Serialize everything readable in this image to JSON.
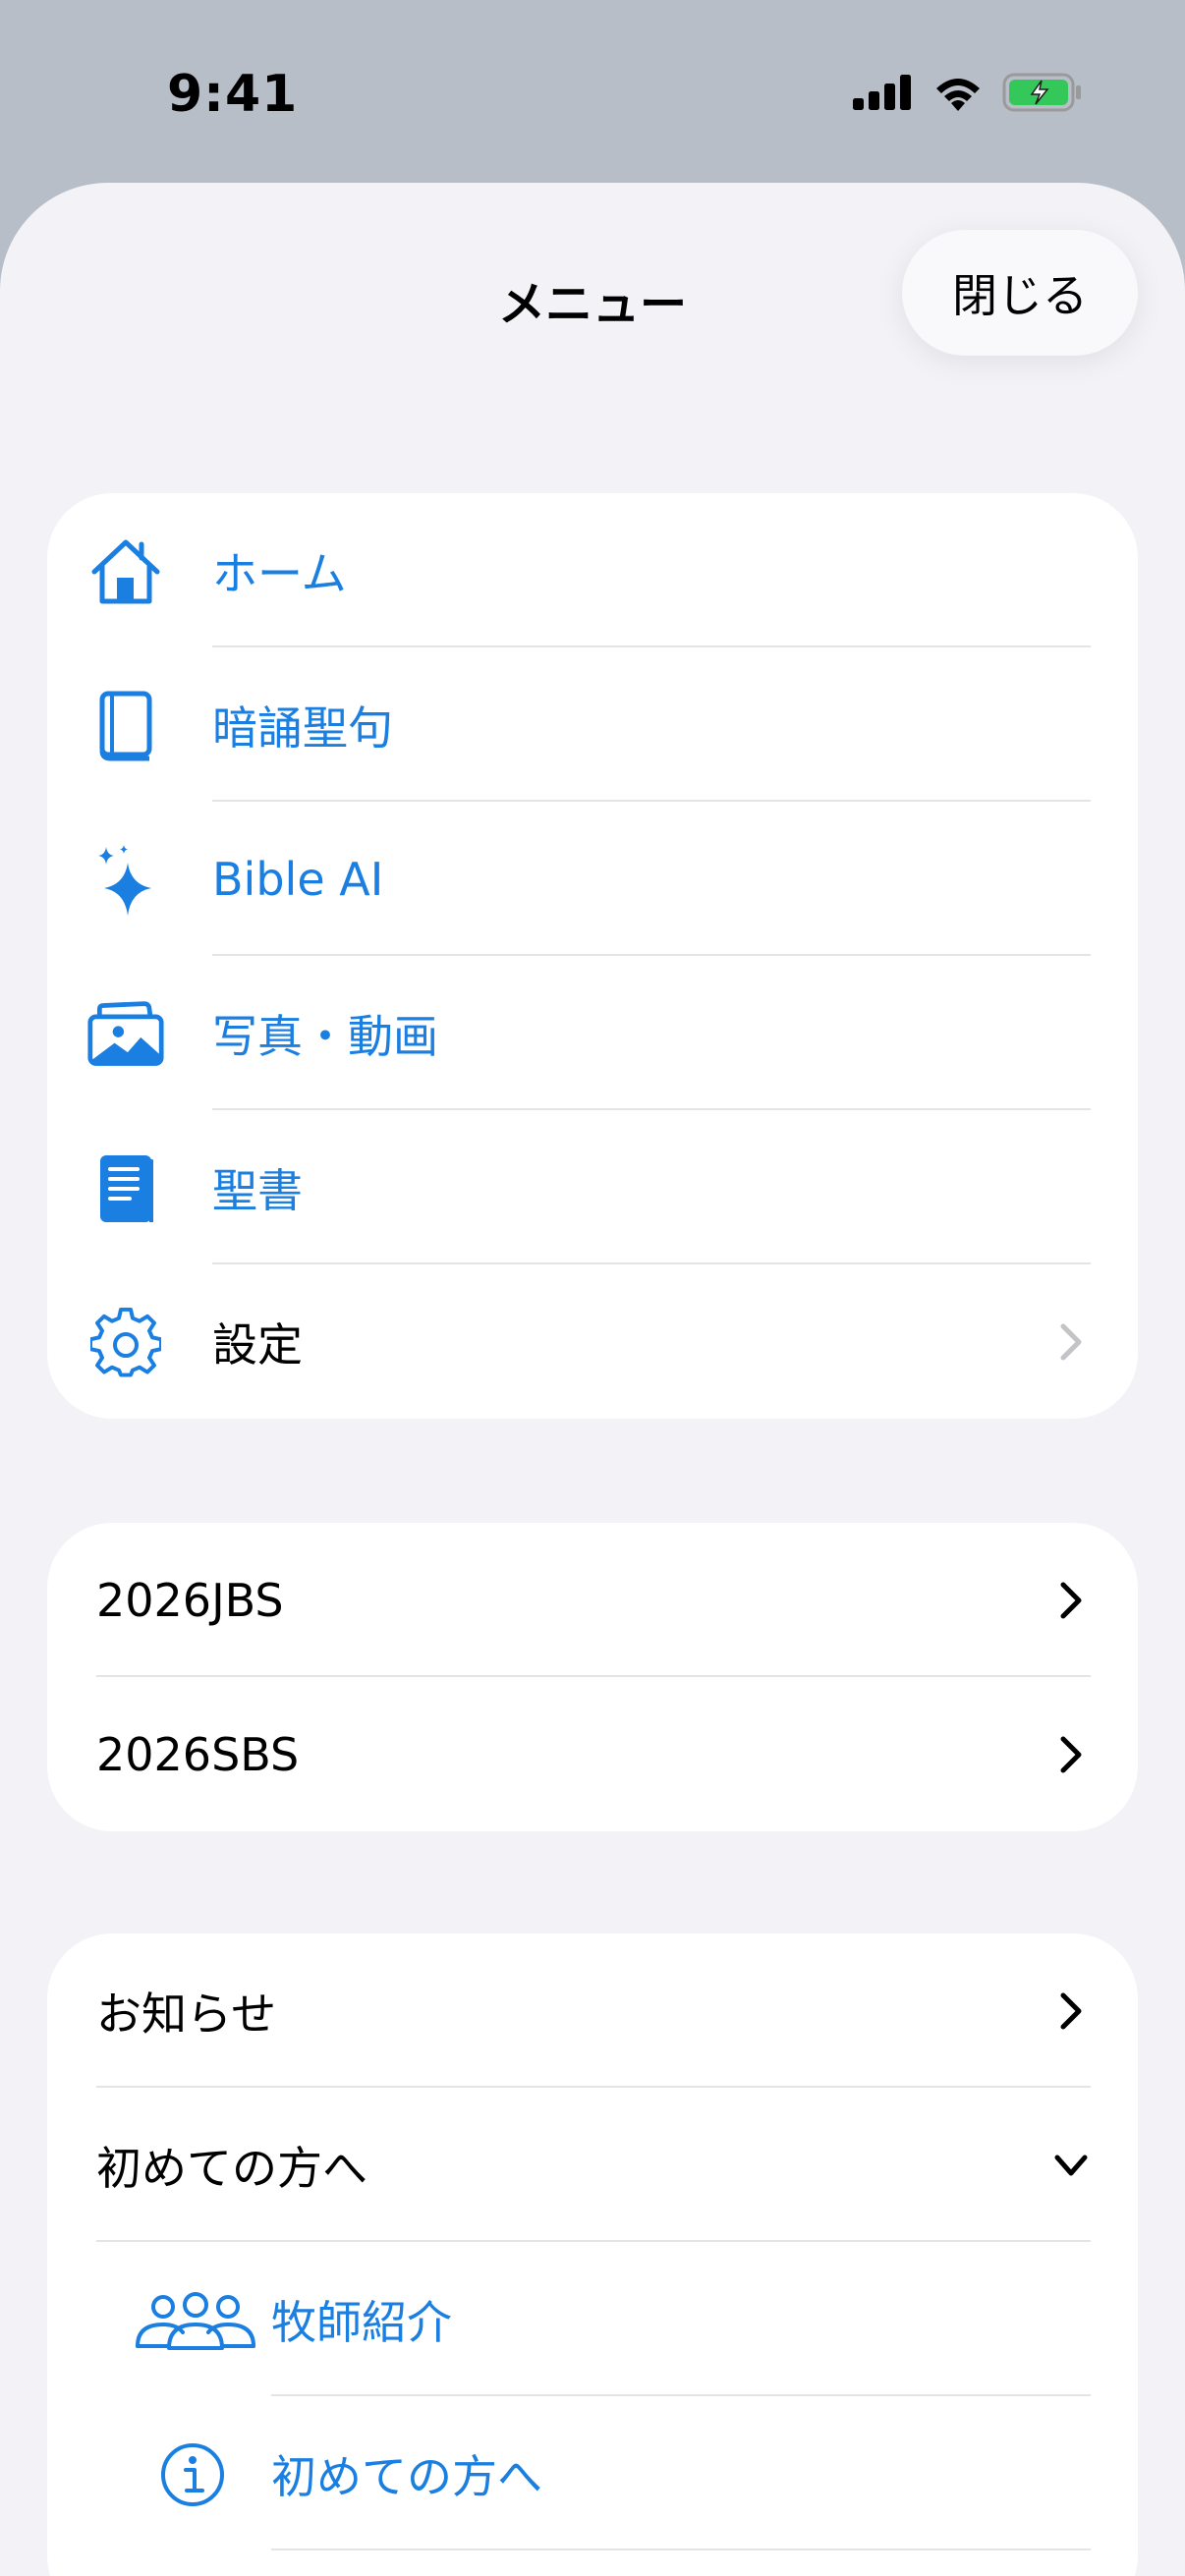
{
  "status": {
    "time": "9:41"
  },
  "sheet": {
    "title": "メニュー",
    "close_label": "閉じる"
  },
  "main_menu": [
    {
      "label": "ホーム",
      "icon": "house-icon"
    },
    {
      "label": "暗誦聖句",
      "icon": "book-icon"
    },
    {
      "label": "Bible AI",
      "icon": "sparkles-icon"
    },
    {
      "label": "写真・動画",
      "icon": "photos-icon"
    },
    {
      "label": "聖書",
      "icon": "book-filled-icon"
    },
    {
      "label": "設定",
      "icon": "gear-icon"
    }
  ],
  "events_menu": [
    {
      "label": "2026JBS"
    },
    {
      "label": "2026SBS"
    }
  ],
  "info_menu": [
    {
      "label": "お知らせ"
    },
    {
      "label": "初めての方へ"
    }
  ],
  "info_submenu": [
    {
      "label": "牧師紹介",
      "icon": "people-icon"
    },
    {
      "label": "初めての方へ",
      "icon": "info-circle-icon"
    }
  ],
  "colors": {
    "accent": "#1a7fe0",
    "background": "#f2f2f7",
    "card": "#ffffff",
    "battery": "#34c759"
  }
}
